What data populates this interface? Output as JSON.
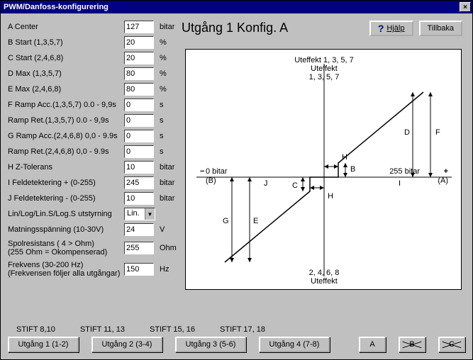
{
  "window": {
    "title": "PWM/Danfoss-konfigurering"
  },
  "header": {
    "title": "Utgång 1   Konfig. A",
    "help_label": "Hjälp",
    "back_label": "Tillbaka"
  },
  "params": {
    "a": {
      "label": "A   Center",
      "value": "127",
      "unit": "bitar"
    },
    "b": {
      "label": "B   Start  (1,3,5,7)",
      "value": "20",
      "unit": "%"
    },
    "c": {
      "label": "C   Start  (2,4,6,8)",
      "value": "20",
      "unit": "%"
    },
    "d": {
      "label": "D   Max  (1,3,5,7)",
      "value": "80",
      "unit": "%"
    },
    "e": {
      "label": "E   Max  (2,4,6,8)",
      "value": "80",
      "unit": "%"
    },
    "f1": {
      "label": "F   Ramp Acc.(1,3,5,7) 0.0 - 9,9s",
      "value": "0",
      "unit": "s",
      "struck": true
    },
    "f2": {
      "label": "     Ramp Ret.(1,3,5,7) 0.0 - 9,9s",
      "value": "0",
      "unit": "s",
      "struck": true
    },
    "g1": {
      "label": "G   Ramp Acc.(2,4,6,8) 0,0 - 9.9s",
      "value": "0",
      "unit": "s",
      "struck": true
    },
    "g2": {
      "label": "     Ramp Ret.(2,4,6,8)  0,0 - 9.9s",
      "value": "0",
      "unit": "s",
      "struck": true
    },
    "h": {
      "label": "H   Z-Tolerans",
      "value": "10",
      "unit": "bitar"
    },
    "i": {
      "label": "I    Feldetektering + (0-255)",
      "value": "245",
      "unit": "bitar"
    },
    "j": {
      "label": "J   Feldetektering - (0-255)",
      "value": "10",
      "unit": "bitar"
    },
    "curve": {
      "label": "Lin/Log/Lin.S/Log.S utstyrning",
      "value": "Lin."
    },
    "supply": {
      "label": "Matningsspänning  (10-30V)",
      "value": "24",
      "unit": "V",
      "struck": true
    },
    "coil": {
      "label": "Spolresistans ( 4  >  Ohm)\n(255 Ohm = Okompenserad)",
      "value": "255",
      "unit": "Ohm",
      "struck": true
    },
    "freq": {
      "label": "Frekvens (30-200 Hz)\n(Frekvensen  följer alla utgångar)",
      "value": "150",
      "unit": "Hz",
      "struck": true
    }
  },
  "bottom": {
    "stift": [
      "STIFT 8,10",
      "STIFT 11, 13",
      "STIFT 15, 16",
      "STIFT 17, 18"
    ],
    "buttons": [
      "Utgång 1 (1-2)",
      "Utgång 2  (3-4)",
      "Utgång 3  (5-6)",
      "Utgång 4 (7-8)"
    ],
    "small": [
      "A",
      "B",
      "C"
    ]
  },
  "chart_data": {
    "type": "line",
    "title_top": "Uteffekt\n1, 3, 5, 7",
    "title_bottom": "2, 4, 6, 8\nUteffekt",
    "x_left": "0 bitar",
    "x_left_sub": "(B)",
    "x_right": "255 bitar",
    "x_right_sub": "(A)",
    "labels": [
      "B",
      "C",
      "D",
      "E",
      "F",
      "G",
      "H",
      "I",
      "J"
    ],
    "x_range": [
      0,
      255
    ],
    "y_range": [
      -100,
      100
    ],
    "series": [
      {
        "name": "transfer-curve",
        "points": [
          [
            10,
            -80
          ],
          [
            117,
            -20
          ],
          [
            117,
            0
          ],
          [
            137,
            0
          ],
          [
            137,
            20
          ],
          [
            245,
            80
          ]
        ]
      }
    ],
    "markers": {
      "center": 127,
      "deadband_half": 10,
      "start_pct": 20,
      "max_pct": 80,
      "fault_pos": 245,
      "fault_neg": 10
    }
  }
}
